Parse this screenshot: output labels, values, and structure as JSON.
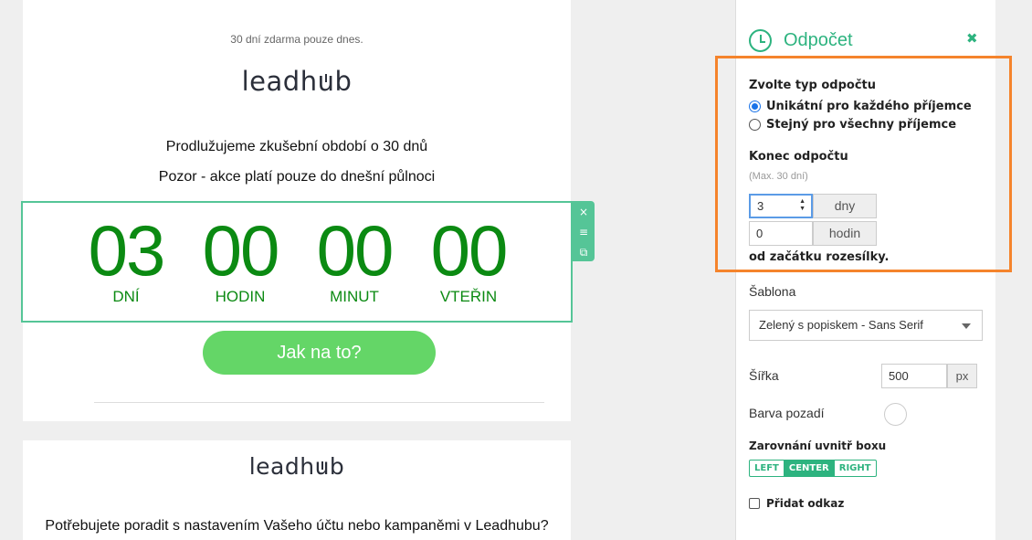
{
  "email": {
    "top_note": "30 dní zdarma pouze dnes.",
    "logo_text_start": "leadh",
    "logo_text_u": "u",
    "logo_text_end": "b",
    "line1": "Prodlužujeme zkušební období o 30 dnů",
    "line2": "Pozor - akce platí pouze do dnešní půlnoci",
    "countdown": [
      {
        "value": "03",
        "label": "DNÍ"
      },
      {
        "value": "00",
        "label": "HODIN"
      },
      {
        "value": "00",
        "label": "MINUT"
      },
      {
        "value": "00",
        "label": "VTEŘIN"
      }
    ],
    "cta_label": "Jak na to?",
    "second_card_text": "Potřebujete poradit s nastavením Vašeho účtu nebo kampaněmi v Leadhubu?",
    "colors": {
      "countdown_green": "#0b8a12",
      "border_accent": "#55c597",
      "cta_bg": "#64d667"
    }
  },
  "block_tools": {
    "close_icon": "×",
    "menu_icon": "≡",
    "copy_icon": "⧉"
  },
  "panel": {
    "title": "Odpočet",
    "close_icon": "✖",
    "type_label": "Zvolte typ odpočtu",
    "type_options": [
      {
        "label": "Unikátní pro každého příjemce",
        "checked": true
      },
      {
        "label": "Stejný pro všechny příjemce",
        "checked": false
      }
    ],
    "end_label": "Konec odpočtu",
    "end_hint": "(Max. 30 dní)",
    "days_value": "3",
    "days_unit": "dny",
    "hours_value": "0",
    "hours_unit": "hodin",
    "from_start": "od začátku rozesílky.",
    "template_label": "Šablona",
    "template_value": "Zelený s popiskem - Sans Serif",
    "width_label": "Šířka",
    "width_value": "500",
    "width_unit": "px",
    "bg_label": "Barva pozadí",
    "align_label": "Zarovnání uvnitř boxu",
    "align_options": [
      "LEFT",
      "CENTER",
      "RIGHT"
    ],
    "align_selected": "CENTER",
    "link_label": "Přidat odkaz",
    "colors": {
      "accent": "#2db37f",
      "highlight": "#f5842c"
    }
  }
}
